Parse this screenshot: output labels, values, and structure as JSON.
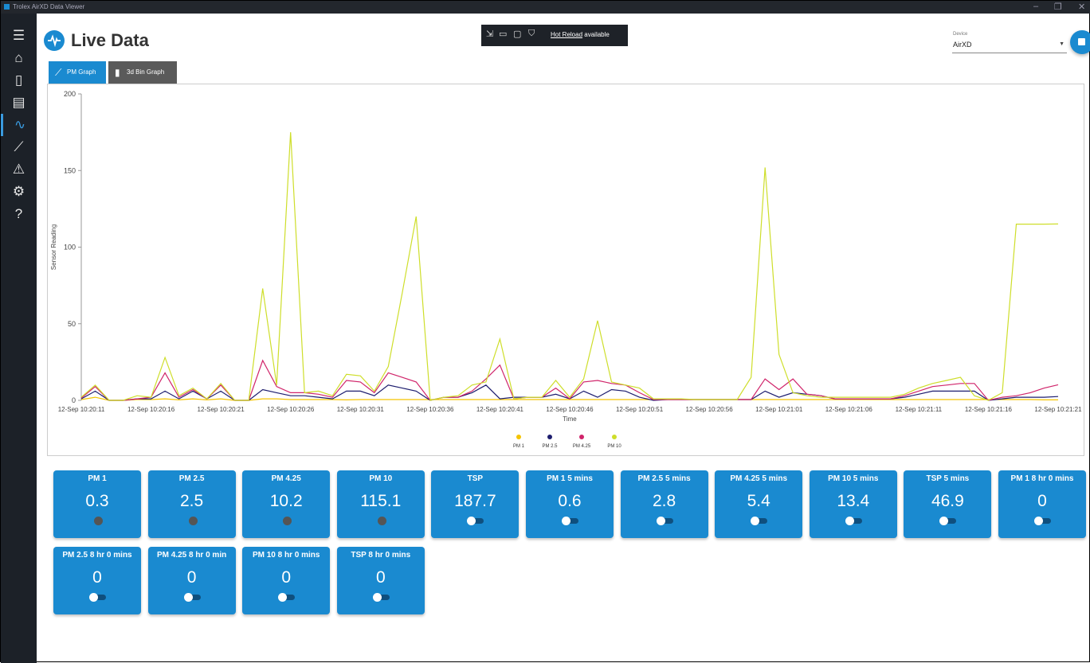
{
  "window": {
    "title": "Trolex AirXD Data Viewer"
  },
  "header": {
    "title": "Live Data"
  },
  "devbar": {
    "hot_reload_link": "Hot Reload",
    "hot_reload_suffix": "available"
  },
  "device": {
    "label": "Device",
    "value": "AirXD"
  },
  "tabs": [
    {
      "label": "PM Graph"
    },
    {
      "label": "3d Bin Graph"
    }
  ],
  "colors": {
    "accent": "#1a8ad0",
    "sidebar": "#1c2128",
    "pm1": "#f5c400",
    "pm25": "#1d1d6e",
    "pm425": "#d0246a",
    "pm10": "#cede2a"
  },
  "sidebar_icons": [
    "menu-icon",
    "home-icon",
    "device-icon",
    "report-icon",
    "live-data-icon",
    "graph-icon",
    "warning-icon",
    "settings-icon",
    "help-icon"
  ],
  "chart_data": {
    "type": "line",
    "xlabel": "Time",
    "ylabel": "Sensor Reading",
    "ylim": [
      0,
      200
    ],
    "yticks": [
      0,
      50,
      100,
      150,
      200
    ],
    "x_tick_labels": [
      "12-Sep 10:20:11",
      "12-Sep 10:20:16",
      "12-Sep 10:20:21",
      "12-Sep 10:20:26",
      "12-Sep 10:20:31",
      "12-Sep 10:20:36",
      "12-Sep 10:20:41",
      "12-Sep 10:20:46",
      "12-Sep 10:20:51",
      "12-Sep 10:20:56",
      "12-Sep 10:21:01",
      "12-Sep 10:21:06",
      "12-Sep 10:21:11",
      "12-Sep 10:21:16",
      "12-Sep 10:21:21"
    ],
    "x": [
      0,
      1,
      2,
      3,
      4,
      5,
      6,
      7,
      8,
      9,
      10,
      11,
      12,
      13,
      14,
      15,
      16,
      17,
      18,
      19,
      20,
      21,
      22,
      23,
      24,
      25,
      26,
      27,
      28,
      29,
      30,
      31,
      32,
      33,
      34,
      35,
      36,
      37,
      38,
      39,
      40,
      41,
      42,
      43,
      44,
      45,
      46,
      47,
      48,
      49,
      50,
      51,
      52,
      53,
      54,
      55,
      56,
      57,
      58,
      59,
      60,
      61,
      62,
      63,
      64,
      65,
      66,
      67,
      68,
      69,
      70
    ],
    "series": [
      {
        "name": "PM 1",
        "values": [
          0.5,
          2,
          0,
          0,
          0.5,
          0.5,
          1,
          0.3,
          1,
          0.3,
          1,
          0,
          0,
          1,
          1,
          0.5,
          0.5,
          0.5,
          0.5,
          0.3,
          0.5,
          0.5,
          0.5,
          0.5,
          0.5,
          0.5,
          0.5,
          0.5,
          0.5,
          0.5,
          0.5,
          0.5,
          0.5,
          0.5,
          0.5,
          0.5,
          0.5,
          0.5,
          0.5,
          0.5,
          0.5,
          0.5,
          0.5,
          0.5,
          0.5,
          0.5,
          0.5,
          0.5,
          0.5,
          0.5,
          0.5,
          0.5,
          0.5,
          0.5,
          0.5,
          0.5,
          0.5,
          0.5,
          0.5,
          0.5,
          0.5,
          0.5,
          0.5,
          0.5,
          0.5,
          0.5,
          0.5,
          0.5,
          0.5,
          0.3,
          0.3
        ]
      },
      {
        "name": "PM 2.5",
        "values": [
          1,
          6,
          0,
          0,
          1,
          1,
          6,
          1,
          6,
          1,
          6,
          0,
          0,
          7,
          5,
          3,
          3,
          2,
          1,
          6,
          6,
          3,
          10,
          8,
          6,
          0,
          2,
          2,
          5,
          10,
          1,
          2,
          2,
          2,
          4,
          1,
          6,
          2,
          7,
          6,
          2,
          0,
          0.5,
          0.5,
          0.5,
          0.5,
          0.5,
          0.5,
          0.5,
          6,
          2,
          5,
          4,
          3,
          1,
          1,
          1,
          1,
          1,
          2,
          4,
          6,
          6,
          6,
          6,
          0,
          1,
          2,
          2,
          2,
          2.5
        ]
      },
      {
        "name": "PM 4.25",
        "values": [
          1.5,
          9,
          0,
          0,
          1,
          2,
          18,
          2,
          7,
          1,
          10,
          0,
          0,
          26,
          9,
          5,
          5,
          4,
          2,
          13,
          12,
          5,
          18,
          15,
          12,
          0,
          2,
          2,
          6,
          14,
          23,
          1,
          2,
          2,
          8,
          1,
          12,
          13,
          11,
          10,
          5,
          0.5,
          0.5,
          0.5,
          0.5,
          0.5,
          0.5,
          0.5,
          0.5,
          14,
          7,
          14,
          4,
          3,
          1,
          1,
          1,
          1,
          1,
          3,
          6,
          9,
          10,
          11,
          11,
          0,
          2,
          3,
          5,
          8,
          10.2
        ]
      },
      {
        "name": "PM 10",
        "values": [
          2,
          10,
          0,
          0,
          3,
          2,
          28,
          3,
          8,
          1,
          11,
          0,
          0,
          73,
          10,
          175,
          5,
          6,
          3,
          17,
          16,
          6,
          22,
          70,
          120,
          0,
          2,
          3,
          10,
          12,
          40,
          1,
          2,
          2,
          13,
          2,
          14,
          52,
          12,
          10,
          8,
          1,
          1,
          1,
          0.5,
          0.5,
          0.5,
          0.5,
          15,
          152,
          30,
          5,
          3,
          2,
          2,
          2,
          2,
          2,
          2,
          4,
          8,
          11,
          13,
          15,
          3,
          0,
          5,
          115,
          115,
          115,
          115.1
        ]
      }
    ]
  },
  "cards": [
    {
      "title": "PM 1",
      "value": "0.3",
      "indicator": "led"
    },
    {
      "title": "PM 2.5",
      "value": "2.5",
      "indicator": "led"
    },
    {
      "title": "PM 4.25",
      "value": "10.2",
      "indicator": "led"
    },
    {
      "title": "PM 10",
      "value": "115.1",
      "indicator": "led"
    },
    {
      "title": "TSP",
      "value": "187.7",
      "indicator": "toggle"
    },
    {
      "title": "PM 1 5 mins",
      "value": "0.6",
      "indicator": "toggle"
    },
    {
      "title": "PM 2.5 5 mins",
      "value": "2.8",
      "indicator": "toggle"
    },
    {
      "title": "PM 4.25 5 mins",
      "value": "5.4",
      "indicator": "toggle"
    },
    {
      "title": "PM 10 5 mins",
      "value": "13.4",
      "indicator": "toggle"
    },
    {
      "title": "TSP 5 mins",
      "value": "46.9",
      "indicator": "toggle"
    },
    {
      "title": "PM 1 8 hr 0 mins",
      "value": "0",
      "indicator": "toggle"
    },
    {
      "title": "PM 2.5 8 hr 0 mins",
      "value": "0",
      "indicator": "toggle"
    },
    {
      "title": "PM 4.25 8 hr 0 min",
      "value": "0",
      "indicator": "toggle"
    },
    {
      "title": "PM 10 8 hr 0 mins",
      "value": "0",
      "indicator": "toggle"
    },
    {
      "title": "TSP 8 hr 0 mins",
      "value": "0",
      "indicator": "toggle"
    }
  ]
}
